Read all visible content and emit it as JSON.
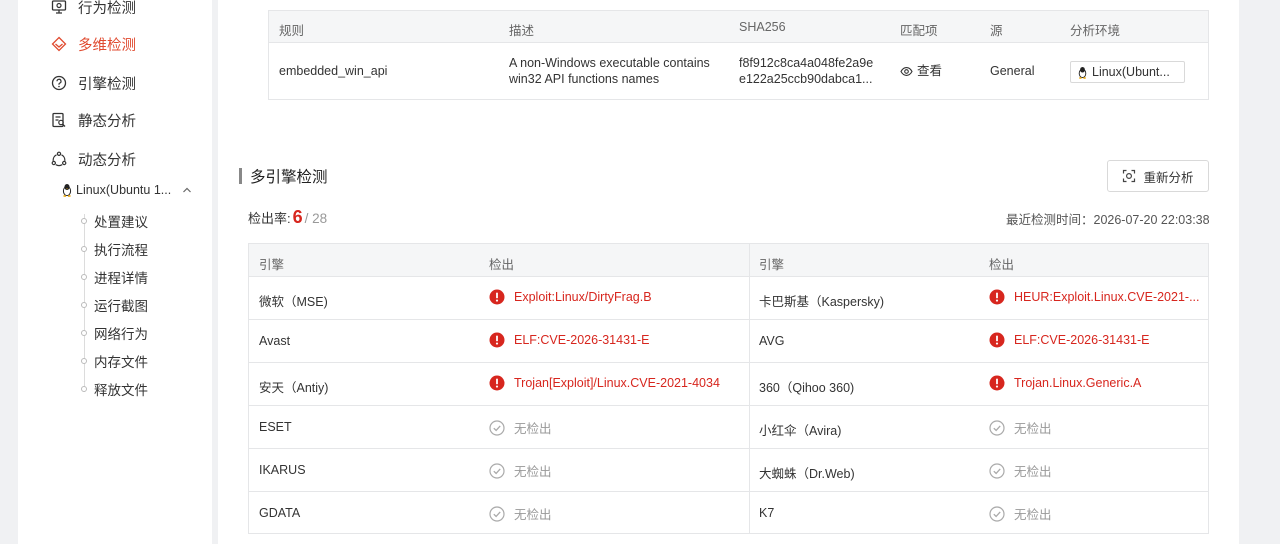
{
  "sidebar": {
    "items": [
      {
        "label": "行为检测",
        "icon": "behavior-detect-icon"
      },
      {
        "label": "多维检测",
        "icon": "multi-dimension-icon",
        "active": true
      },
      {
        "label": "引擎检测",
        "icon": "engine-detect-icon"
      },
      {
        "label": "静态分析",
        "icon": "static-analysis-icon"
      },
      {
        "label": "动态分析",
        "icon": "dynamic-analysis-icon"
      }
    ],
    "env": {
      "label": "Linux(Ubuntu 1...",
      "icon": "linux-tux-icon"
    },
    "sub_items": [
      "处置建议",
      "执行流程",
      "进程详情",
      "运行截图",
      "网络行为",
      "内存文件",
      "释放文件"
    ]
  },
  "yara": {
    "headers": [
      "规则",
      "描述",
      "SHA256",
      "匹配项",
      "源",
      "分析环境"
    ],
    "row": {
      "rule": "embedded_win_api",
      "desc_line1": "A non-Windows executable contains",
      "desc_line2": "win32 API functions names",
      "sha_line1": "f8f912c8ca4a048fe2a9e",
      "sha_line2": "e122a25ccb90dabca1...",
      "match": "查看",
      "source": "General",
      "env": "Linux(Ubunt..."
    }
  },
  "engine_section": {
    "title": "多引擎检测",
    "reanalyze": "重新分析",
    "rate_label": "检出率:",
    "rate_num": "6",
    "rate_total": "/ 28",
    "last_time": "最近检测时间：2026-07-20 22:03:38",
    "headers": [
      "引擎",
      "检出",
      "引擎",
      "检出"
    ],
    "rows": [
      {
        "e1": "微软（MSE)",
        "d1": "Exploit:Linux/DirtyFrag.B",
        "h1": true,
        "e2": "卡巴斯基（Kaspersky)",
        "d2": "HEUR:Exploit.Linux.CVE-2021-...",
        "h2": true
      },
      {
        "e1": "Avast",
        "d1": "ELF:CVE-2026-31431-E",
        "h1": true,
        "e2": "AVG",
        "d2": "ELF:CVE-2026-31431-E",
        "h2": true
      },
      {
        "e1": "安天（Antiy)",
        "d1": "Trojan[Exploit]/Linux.CVE-2021-4034",
        "h1": true,
        "e2": "360（Qihoo 360)",
        "d2": "Trojan.Linux.Generic.A",
        "h2": true
      },
      {
        "e1": "ESET",
        "d1": "无检出",
        "h1": false,
        "e2": "小红伞（Avira)",
        "d2": "无检出",
        "h2": false
      },
      {
        "e1": "IKARUS",
        "d1": "无检出",
        "h1": false,
        "e2": "大蜘蛛（Dr.Web)",
        "d2": "无检出",
        "h2": false
      },
      {
        "e1": "GDATA",
        "d1": "无检出",
        "h1": false,
        "e2": "K7",
        "d2": "无检出",
        "h2": false
      }
    ]
  },
  "colors": {
    "accent": "#e04a2f",
    "danger": "#d7261e"
  }
}
